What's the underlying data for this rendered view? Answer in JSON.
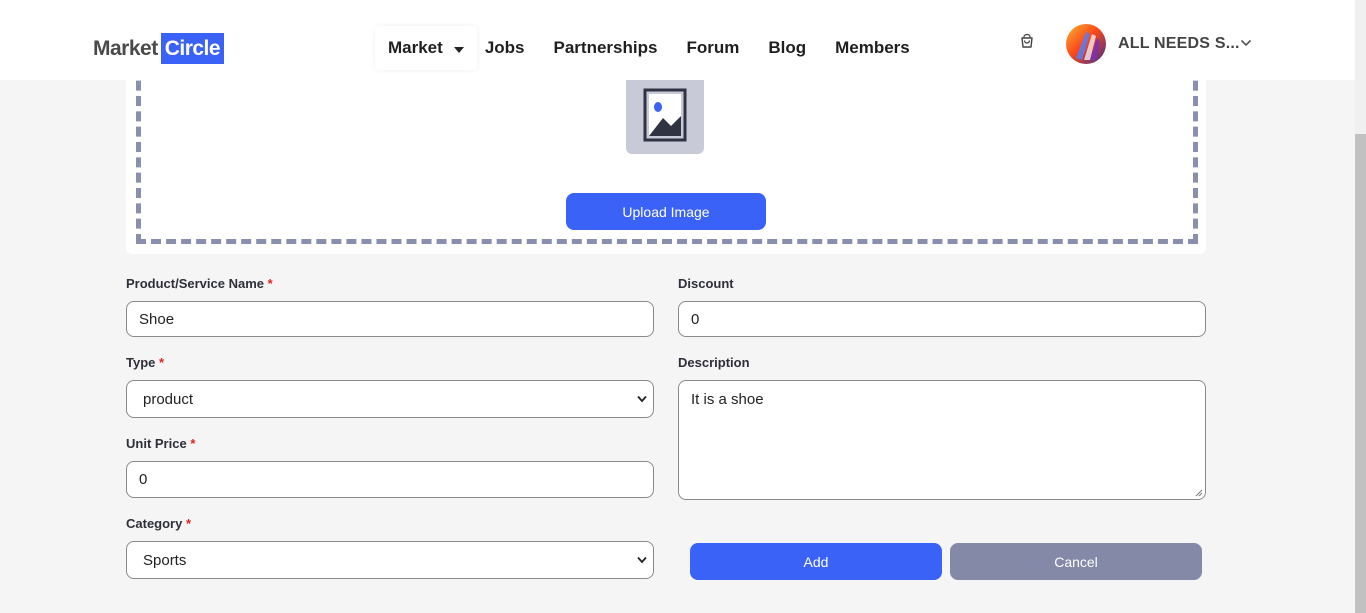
{
  "header": {
    "logo_part1": "Market",
    "logo_part2": "Circle",
    "nav": {
      "market": "Market",
      "jobs": "Jobs",
      "partnerships": "Partnerships",
      "forum": "Forum",
      "blog": "Blog",
      "members": "Members"
    },
    "cart_icon": "shopping-bag-icon",
    "user_name": "ALL NEEDS S..."
  },
  "upload": {
    "icon": "image-icon",
    "button_label": "Upload Image"
  },
  "form": {
    "name": {
      "label": "Product/Service Name",
      "required": "*",
      "value": "Shoe"
    },
    "discount": {
      "label": "Discount",
      "value": "0"
    },
    "type": {
      "label": "Type",
      "required": "*",
      "value": "product"
    },
    "description": {
      "label": "Description",
      "value": "It is a shoe"
    },
    "unit_price": {
      "label": "Unit Price",
      "required": "*",
      "value": "0"
    },
    "category": {
      "label": "Category",
      "required": "*",
      "value": "Sports"
    },
    "add_label": "Add",
    "cancel_label": "Cancel"
  },
  "colors": {
    "primary": "#3b62f6",
    "secondary": "#8389a6",
    "required": "#e02424"
  }
}
